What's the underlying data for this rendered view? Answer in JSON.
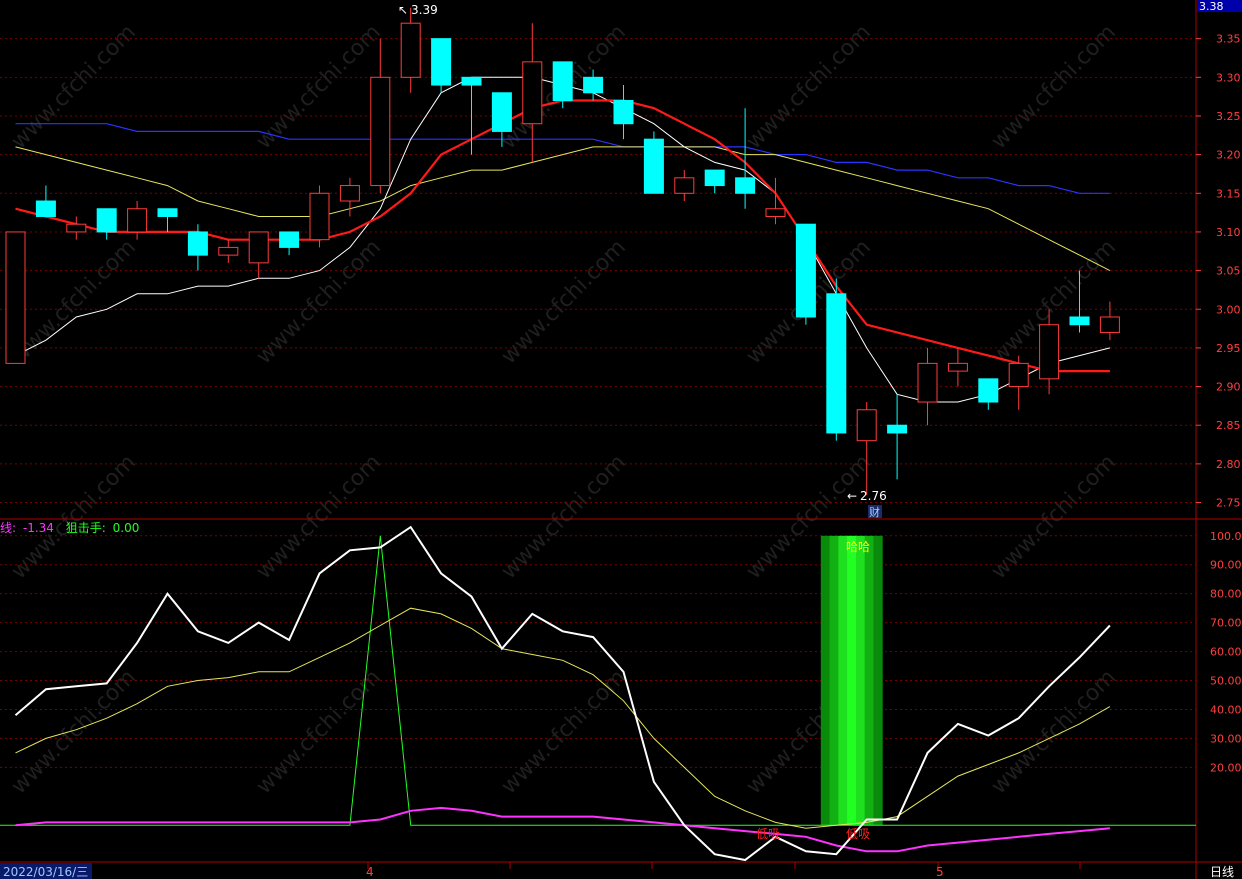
{
  "app": {
    "period_label": "日线",
    "date_label": "2022/03/16/三",
    "current_price_badge": "3.38",
    "watermark": "www.cfchi.com",
    "earnings_marker": "财"
  },
  "colors": {
    "background": "#000000",
    "up_candle": "#ff3b3b",
    "down_candle": "#00ffff",
    "grid": "#7a0000",
    "axis_text": "#ff4040",
    "ma_white": "#ffffff",
    "ma_red": "#ff1a1a",
    "ma_yellow": "#e6e65c",
    "ma_blue": "#2b33ff",
    "ind_magenta": "#ff33ff",
    "ind_green": "#22ff22"
  },
  "top_panel": {
    "y_ticks": [
      "3.35",
      "3.30",
      "3.25",
      "3.20",
      "3.15",
      "3.10",
      "3.05",
      "3.00",
      "2.95",
      "2.90",
      "2.85",
      "2.80",
      "2.75"
    ],
    "high_label": "3.39",
    "low_label": "2.76"
  },
  "bottom_panel": {
    "legend_a_label": "线:",
    "legend_a_value": "-1.34",
    "legend_b_label": "狙击手:",
    "legend_b_value": "0.00",
    "y_ticks": [
      "100.00",
      "90.00",
      "80.00",
      "70.00",
      "60.00",
      "50.00",
      "40.00",
      "30.00",
      "20.00"
    ],
    "signal_top": "哈哈",
    "signal_low_a": "低吸",
    "signal_low_b": "低吸"
  },
  "x_axis": {
    "month_labels": [
      "4",
      "5"
    ]
  },
  "chart_data": {
    "type": "candlestick",
    "ylim": [
      2.73,
      3.4
    ],
    "candles": [
      {
        "o": 2.93,
        "h": 3.1,
        "l": 2.98,
        "c": 3.1,
        "up": true
      },
      {
        "o": 3.14,
        "h": 3.16,
        "l": 3.12,
        "c": 3.12,
        "up": false
      },
      {
        "o": 3.1,
        "h": 3.12,
        "l": 3.09,
        "c": 3.11,
        "up": true
      },
      {
        "o": 3.13,
        "h": 3.13,
        "l": 3.09,
        "c": 3.1,
        "up": false
      },
      {
        "o": 3.1,
        "h": 3.14,
        "l": 3.09,
        "c": 3.13,
        "up": true
      },
      {
        "o": 3.13,
        "h": 3.13,
        "l": 3.1,
        "c": 3.12,
        "up": false
      },
      {
        "o": 3.1,
        "h": 3.11,
        "l": 3.05,
        "c": 3.07,
        "up": false
      },
      {
        "o": 3.07,
        "h": 3.09,
        "l": 3.06,
        "c": 3.08,
        "up": true
      },
      {
        "o": 3.06,
        "h": 3.1,
        "l": 3.04,
        "c": 3.1,
        "up": true
      },
      {
        "o": 3.1,
        "h": 3.1,
        "l": 3.07,
        "c": 3.08,
        "up": false
      },
      {
        "o": 3.09,
        "h": 3.16,
        "l": 3.08,
        "c": 3.15,
        "up": true
      },
      {
        "o": 3.14,
        "h": 3.17,
        "l": 3.12,
        "c": 3.16,
        "up": true
      },
      {
        "o": 3.16,
        "h": 3.35,
        "l": 3.15,
        "c": 3.3,
        "up": true
      },
      {
        "o": 3.3,
        "h": 3.39,
        "l": 3.28,
        "c": 3.37,
        "up": true
      },
      {
        "o": 3.35,
        "h": 3.35,
        "l": 3.28,
        "c": 3.29,
        "up": false
      },
      {
        "o": 3.3,
        "h": 3.3,
        "l": 3.2,
        "c": 3.29,
        "up": false
      },
      {
        "o": 3.28,
        "h": 3.28,
        "l": 3.21,
        "c": 3.23,
        "up": false
      },
      {
        "o": 3.24,
        "h": 3.37,
        "l": 3.19,
        "c": 3.32,
        "up": true
      },
      {
        "o": 3.32,
        "h": 3.32,
        "l": 3.26,
        "c": 3.27,
        "up": false
      },
      {
        "o": 3.3,
        "h": 3.31,
        "l": 3.27,
        "c": 3.28,
        "up": false
      },
      {
        "o": 3.27,
        "h": 3.29,
        "l": 3.22,
        "c": 3.24,
        "up": false
      },
      {
        "o": 3.22,
        "h": 3.23,
        "l": 3.15,
        "c": 3.15,
        "up": false
      },
      {
        "o": 3.15,
        "h": 3.18,
        "l": 3.14,
        "c": 3.17,
        "up": true
      },
      {
        "o": 3.18,
        "h": 3.18,
        "l": 3.15,
        "c": 3.16,
        "up": false
      },
      {
        "o": 3.17,
        "h": 3.26,
        "l": 3.13,
        "c": 3.15,
        "up": false
      },
      {
        "o": 3.12,
        "h": 3.17,
        "l": 3.11,
        "c": 3.13,
        "up": true
      },
      {
        "o": 3.11,
        "h": 3.11,
        "l": 2.98,
        "c": 2.99,
        "up": false
      },
      {
        "o": 3.02,
        "h": 3.04,
        "l": 2.83,
        "c": 2.84,
        "up": false
      },
      {
        "o": 2.83,
        "h": 2.88,
        "l": 2.76,
        "c": 2.87,
        "up": true
      },
      {
        "o": 2.85,
        "h": 2.89,
        "l": 2.78,
        "c": 2.84,
        "up": false
      },
      {
        "o": 2.88,
        "h": 2.95,
        "l": 2.85,
        "c": 2.93,
        "up": true
      },
      {
        "o": 2.93,
        "h": 2.95,
        "l": 2.9,
        "c": 2.92,
        "up": true
      },
      {
        "o": 2.91,
        "h": 2.91,
        "l": 2.87,
        "c": 2.88,
        "up": false
      },
      {
        "o": 2.9,
        "h": 2.94,
        "l": 2.87,
        "c": 2.93,
        "up": true
      },
      {
        "o": 2.91,
        "h": 3.0,
        "l": 2.89,
        "c": 2.98,
        "up": true
      },
      {
        "o": 2.99,
        "h": 3.05,
        "l": 2.97,
        "c": 2.98,
        "up": false
      },
      {
        "o": 2.97,
        "h": 3.01,
        "l": 2.96,
        "c": 2.99,
        "up": true
      }
    ],
    "ma_white": [
      2.94,
      2.96,
      2.99,
      3.0,
      3.02,
      3.02,
      3.03,
      3.03,
      3.04,
      3.04,
      3.05,
      3.08,
      3.13,
      3.22,
      3.28,
      3.3,
      3.3,
      3.3,
      3.29,
      3.28,
      3.26,
      3.24,
      3.21,
      3.19,
      3.18,
      3.15,
      3.09,
      3.02,
      2.95,
      2.89,
      2.88,
      2.88,
      2.89,
      2.91,
      2.93,
      2.94,
      2.95
    ],
    "ma_red": [
      3.13,
      3.12,
      3.11,
      3.1,
      3.1,
      3.1,
      3.1,
      3.09,
      3.09,
      3.09,
      3.09,
      3.1,
      3.12,
      3.15,
      3.2,
      3.22,
      3.24,
      3.26,
      3.27,
      3.27,
      3.27,
      3.26,
      3.24,
      3.22,
      3.19,
      3.15,
      3.09,
      3.03,
      2.98,
      2.97,
      2.96,
      2.95,
      2.94,
      2.93,
      2.92,
      2.92,
      2.92
    ],
    "ma_yellow": [
      3.21,
      3.2,
      3.19,
      3.18,
      3.17,
      3.16,
      3.14,
      3.13,
      3.12,
      3.12,
      3.12,
      3.13,
      3.14,
      3.16,
      3.17,
      3.18,
      3.18,
      3.19,
      3.2,
      3.21,
      3.21,
      3.21,
      3.21,
      3.21,
      3.2,
      3.2,
      3.19,
      3.18,
      3.17,
      3.16,
      3.15,
      3.14,
      3.13,
      3.11,
      3.09,
      3.07,
      3.05
    ],
    "ma_blue": [
      3.24,
      3.24,
      3.24,
      3.24,
      3.23,
      3.23,
      3.23,
      3.23,
      3.23,
      3.22,
      3.22,
      3.22,
      3.22,
      3.22,
      3.22,
      3.22,
      3.22,
      3.22,
      3.22,
      3.22,
      3.21,
      3.21,
      3.21,
      3.21,
      3.21,
      3.2,
      3.2,
      3.19,
      3.19,
      3.18,
      3.18,
      3.17,
      3.17,
      3.16,
      3.16,
      3.15,
      3.15
    ],
    "indicator": {
      "ylim": [
        -12,
        102
      ],
      "white": [
        38,
        47,
        48,
        49,
        63,
        80,
        67,
        63,
        70,
        64,
        87,
        95,
        96,
        103,
        87,
        79,
        61,
        73,
        67,
        65,
        53,
        15,
        0,
        -10,
        -12,
        -4,
        -9,
        -10,
        2,
        2,
        25,
        35,
        31,
        37,
        48,
        58,
        69
      ],
      "yellow": [
        25,
        30,
        33,
        37,
        42,
        48,
        50,
        51,
        53,
        53,
        58,
        63,
        69,
        75,
        73,
        68,
        61,
        59,
        57,
        52,
        43,
        30,
        20,
        10,
        5,
        1,
        -1,
        0,
        1,
        3,
        10,
        17,
        21,
        25,
        30,
        35,
        41
      ],
      "magenta": [
        0,
        1,
        1,
        1,
        1,
        1,
        1,
        1,
        1,
        1,
        1,
        1,
        2,
        5,
        6,
        5,
        3,
        3,
        3,
        3,
        2,
        1,
        0,
        -1,
        -2,
        -3,
        -4,
        -7,
        -9,
        -9,
        -7,
        -6,
        -5,
        -4,
        -3,
        -2,
        -1
      ],
      "green_spike_index": 12,
      "signal_bar_indices": [
        27,
        28
      ]
    }
  }
}
